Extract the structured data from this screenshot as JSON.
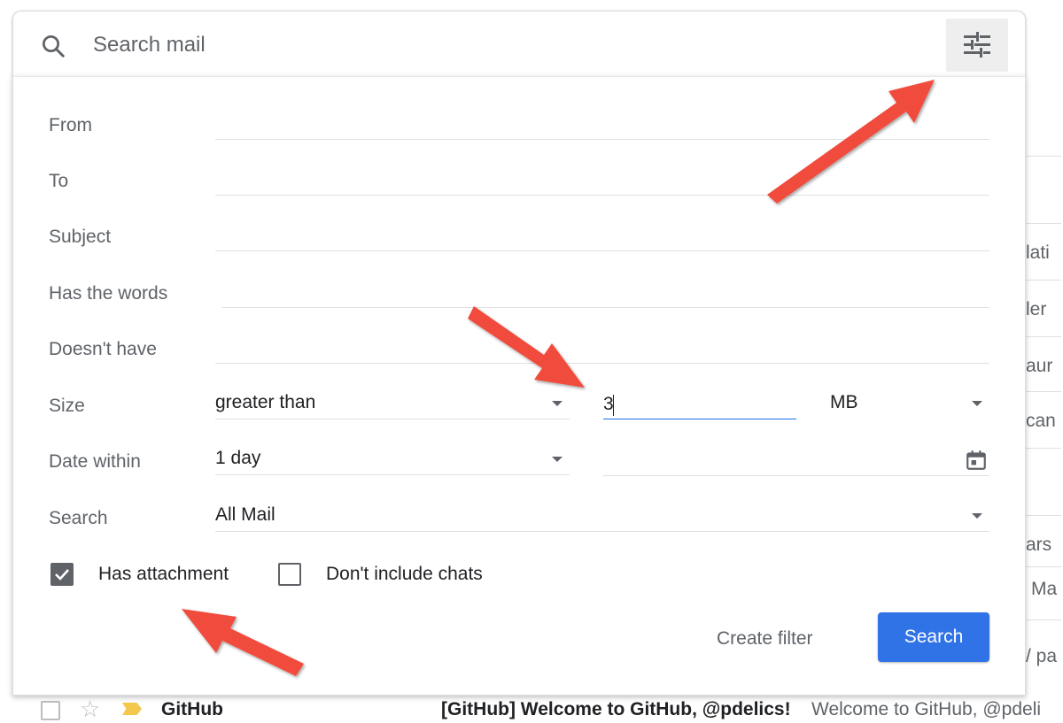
{
  "search": {
    "placeholder": "Search mail",
    "options_icon": "tune-sliders-icon"
  },
  "form": {
    "from_label": "From",
    "to_label": "To",
    "subject_label": "Subject",
    "has_words_label": "Has the words",
    "doesnt_have_label": "Doesn't have",
    "size_label": "Size",
    "size_comparator": "greater than",
    "size_value": "3",
    "size_unit": "MB",
    "date_within_label": "Date within",
    "date_within_value": "1 day",
    "search_in_label": "Search",
    "search_in_value": "All Mail",
    "has_attachment_label": "Has attachment",
    "has_attachment_checked": true,
    "dont_include_chats_label": "Don't include chats",
    "dont_include_chats_checked": false,
    "create_filter_label": "Create filter",
    "search_button_label": "Search"
  },
  "background": {
    "fragments": [
      "lati",
      "ler",
      "aur",
      "can",
      "ars",
      "Ma",
      "/ pa"
    ],
    "row": {
      "sender": "GitHub",
      "subject": "[GitHub] Welcome to GitHub, @pdelics!",
      "snippet": "Welcome to GitHub, @pdeli"
    }
  },
  "colors": {
    "accent": "#2f73e6",
    "arrow": "#f04b3c",
    "label": "#5f6368"
  }
}
